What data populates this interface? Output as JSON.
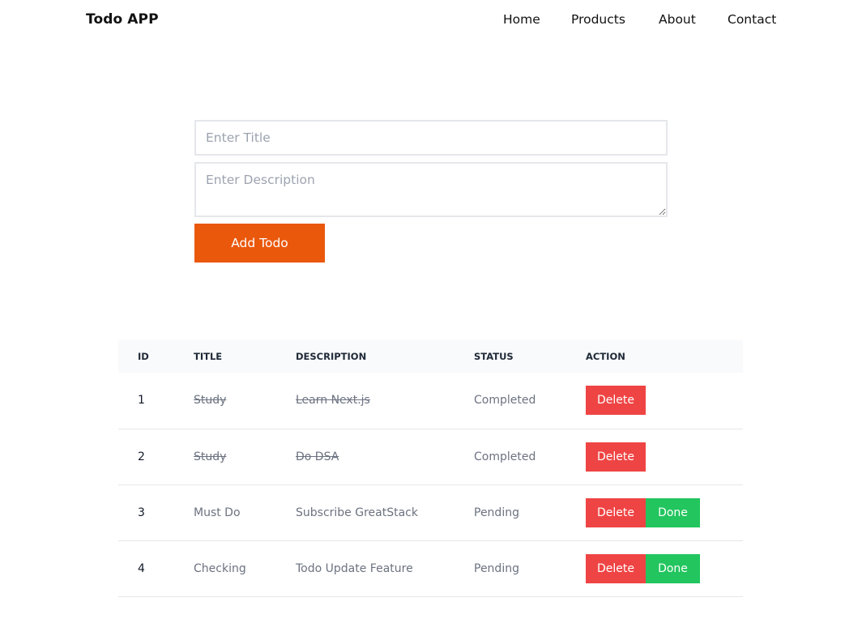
{
  "navbar": {
    "brand": "Todo APP",
    "links": [
      "Home",
      "Products",
      "About",
      "Contact"
    ]
  },
  "form": {
    "title_placeholder": "Enter Title",
    "description_placeholder": "Enter Description",
    "title_value": "",
    "description_value": "",
    "add_label": "Add Todo"
  },
  "table": {
    "headers": [
      "ID",
      "TITLE",
      "DESCRIPTION",
      "STATUS",
      "ACTION"
    ],
    "rows": [
      {
        "id": "1",
        "title": "Study",
        "description": "Learn Next.js",
        "status": "Completed",
        "done": true
      },
      {
        "id": "2",
        "title": "Study",
        "description": "Do DSA",
        "status": "Completed",
        "done": true
      },
      {
        "id": "3",
        "title": "Must Do",
        "description": "Subscribe GreatStack",
        "status": "Pending",
        "done": false
      },
      {
        "id": "4",
        "title": "Checking",
        "description": "Todo Update Feature",
        "status": "Pending",
        "done": false
      }
    ],
    "delete_label": "Delete",
    "done_label": "Done"
  },
  "colors": {
    "accent": "#ea580c",
    "delete": "#ef4444",
    "done": "#22c55e",
    "header_bg": "#f9fafb"
  }
}
